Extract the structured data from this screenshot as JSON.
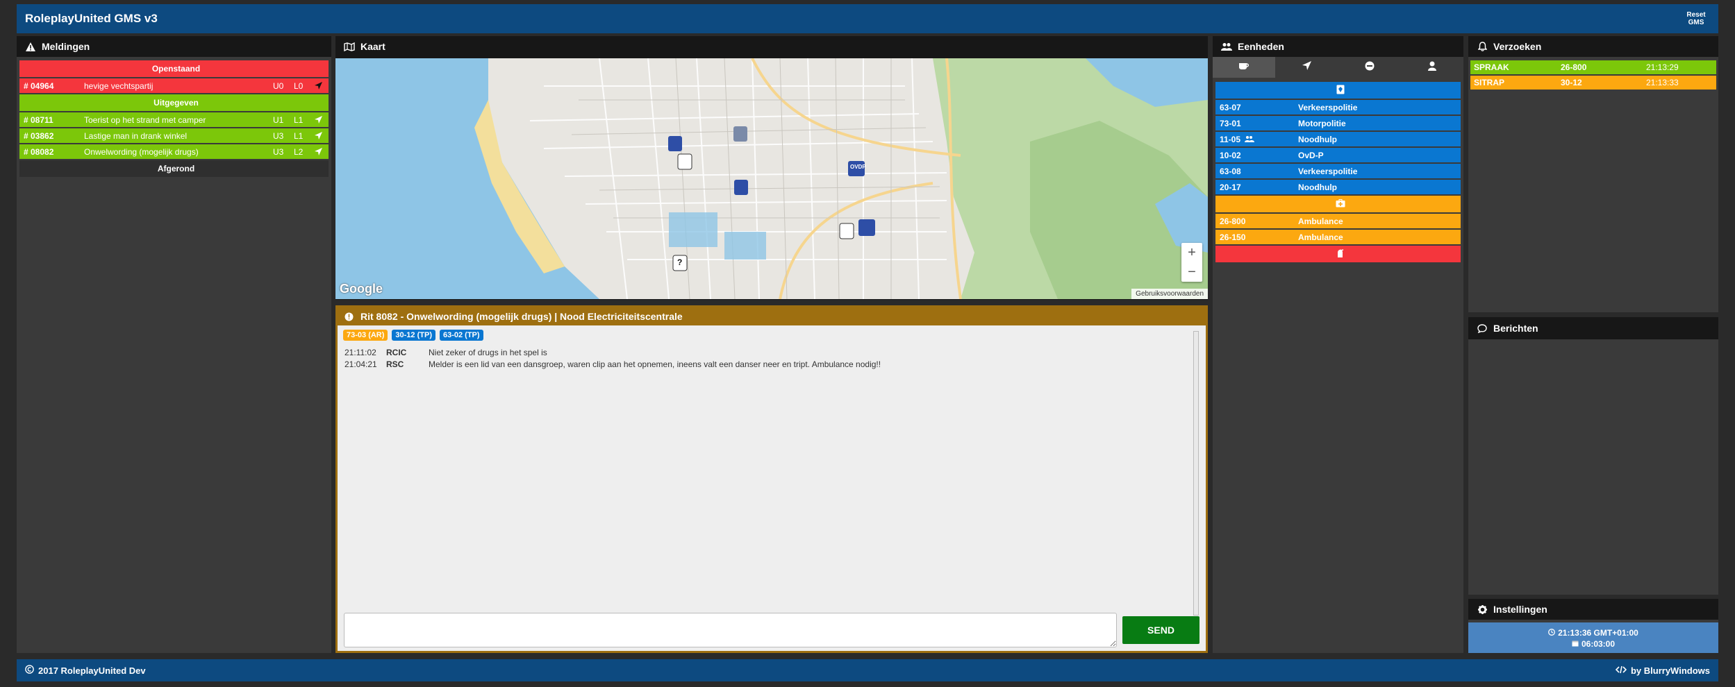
{
  "app": {
    "title": "RoleplayUnited GMS v3",
    "reset_label": "Reset GMS"
  },
  "meldingen": {
    "title": "Meldingen",
    "open_label": "Openstaand",
    "open_items": [
      {
        "id": "# 04964",
        "text": "hevige vechtspartij",
        "u": "U0",
        "l": "L0"
      }
    ],
    "issued_label": "Uitgegeven",
    "issued_items": [
      {
        "id": "# 08711",
        "text": "Toerist op het strand met camper",
        "u": "U1",
        "l": "L1"
      },
      {
        "id": "# 03862",
        "text": "Lastige man in drank winkel",
        "u": "U3",
        "l": "L1"
      },
      {
        "id": "# 08082",
        "text": "Onwelwording (mogelijk drugs)",
        "u": "U3",
        "l": "L2"
      }
    ],
    "closed_label": "Afgerond"
  },
  "kaart": {
    "title": "Kaart",
    "google_label": "Google",
    "terms_label": "Gebruiksvoorwaarden",
    "zoom_in": "+",
    "zoom_out": "−",
    "marker_unknown": "?",
    "marker_ovdp": "OVDP"
  },
  "rit": {
    "title": "Rit 8082 - Onwelwording (mogelijk drugs) | Nood Electriciteitscentrale",
    "units": [
      {
        "label": "73-03 (AR)",
        "color": "#fca810"
      },
      {
        "label": "30-12 (TP)",
        "color": "#0a77d1"
      },
      {
        "label": "63-02 (TP)",
        "color": "#0a77d1"
      }
    ],
    "log": [
      {
        "time": "21:11:02",
        "who": "RCIC",
        "msg": "Niet zeker of drugs in het spel is"
      },
      {
        "time": "21:04:21",
        "who": "RSC",
        "msg": "Melder is een lid van een dansgroep, waren clip aan het opnemen, ineens valt een danser neer en tript. Ambulance nodig!!"
      }
    ],
    "message_value": "",
    "send_label": "SEND"
  },
  "eenheden": {
    "title": "Eenheden",
    "police": [
      {
        "id": "63-07",
        "type": "Verkeerspolitie"
      },
      {
        "id": "73-01",
        "type": "Motorpolitie"
      },
      {
        "id": "11-05",
        "type": "Noodhulp"
      },
      {
        "id": "10-02",
        "type": "OvD-P"
      },
      {
        "id": "63-08",
        "type": "Verkeerspolitie"
      },
      {
        "id": "20-17",
        "type": "Noodhulp"
      }
    ],
    "ambulance": [
      {
        "id": "26-800",
        "type": "Ambulance"
      },
      {
        "id": "26-150",
        "type": "Ambulance"
      }
    ]
  },
  "verzoeken": {
    "title": "Verzoeken",
    "items": [
      {
        "name": "SPRAAK",
        "unit": "26-800",
        "time": "21:13:29",
        "color": "#7cc70a"
      },
      {
        "name": "SITRAP",
        "unit": "30-12",
        "time": "21:13:33",
        "color": "#fca810"
      }
    ]
  },
  "berichten": {
    "title": "Berichten"
  },
  "instellingen": {
    "title": "Instellingen",
    "clock": "21:13:36 GMT+01:00",
    "date": "06:03:00"
  },
  "footer": {
    "copyright": "2017 RoleplayUnited Dev",
    "credit": "by BlurryWindows"
  }
}
